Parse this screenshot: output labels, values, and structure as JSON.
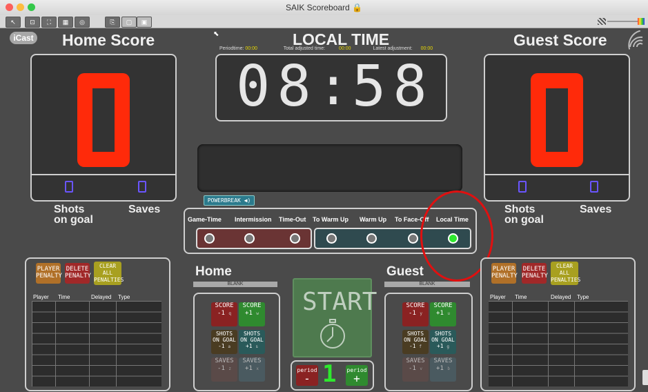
{
  "window": {
    "title": "SAIK Scoreboard 🔒"
  },
  "logo": "iCast",
  "home": {
    "title": "Home Score",
    "score": "0",
    "shots": "0",
    "saves": "0",
    "shots_label": "Shots on goal",
    "saves_label": "Saves",
    "section_title": "Home",
    "dropdown": "BLANK"
  },
  "guest": {
    "title": "Guest Score",
    "score": "0",
    "shots": "0",
    "saves": "0",
    "shots_label": "Shots on goal",
    "saves_label": "Saves",
    "section_title": "Guest",
    "dropdown": "BLANK"
  },
  "clock": {
    "title": "LOCAL TIME",
    "periodtime_label": "Periodtime:",
    "periodtime_value": "00:00",
    "adjusted_label": "Total adjusted time:",
    "adjusted_value": "00:00",
    "latest_label": "Latest adjustment:",
    "latest_value": "00:00",
    "minutes": "08",
    "seconds": "58",
    "separator": ":"
  },
  "powerbreak": "POWERBREAK ◀)",
  "modes": [
    "Game-Time",
    "Intermission",
    "Time-Out",
    "To Warm Up",
    "Warm Up",
    "To Face-Off",
    "Local Time"
  ],
  "penalty_buttons": {
    "player": "PLAYER PENALTY",
    "delete": "DELETE PENALTY",
    "clear": "CLEAR ALL PENALTIES"
  },
  "penalty_table": {
    "headers": [
      "Player",
      "Time",
      "Delayed",
      "Type"
    ]
  },
  "score_buttons": {
    "score_minus": "SCORE -1",
    "score_plus": "SCORE +1",
    "shots_minus": "SHOTS ON GOAL -1",
    "shots_plus": "SHOTS ON GOAL +1",
    "saves_minus": "SAVES -1",
    "saves_plus": "SAVES +1"
  },
  "home_hotkeys": {
    "score_minus": "q",
    "score_plus": "w",
    "shots_minus": "a",
    "shots_plus": "s",
    "saves_minus": "z",
    "saves_plus": "x"
  },
  "guest_hotkeys": {
    "score_minus": "y",
    "score_plus": "u",
    "shots_minus": "f",
    "shots_plus": "g",
    "saves_minus": "v",
    "saves_plus": "b"
  },
  "start": "START",
  "period": {
    "minus_label": "period",
    "minus_sign": "-",
    "value": "1",
    "plus_label": "period",
    "plus_sign": "+"
  },
  "colors": {
    "score": "#ff2a0a",
    "counter": "#6a55ff",
    "led_on": "#2ee82e",
    "highlight": "#e01010"
  }
}
